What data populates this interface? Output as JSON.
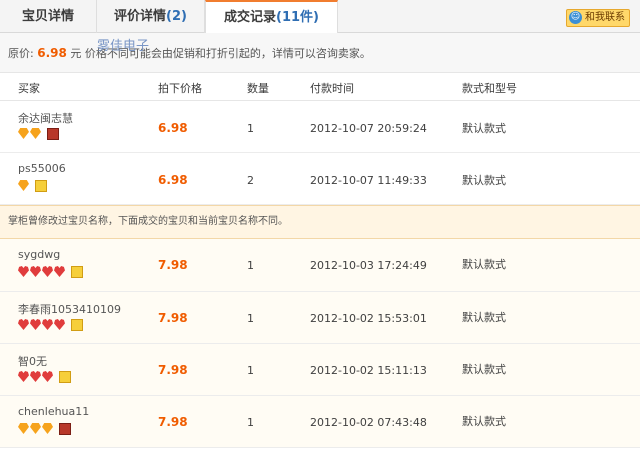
{
  "tabs": [
    {
      "label": "宝贝详情"
    },
    {
      "label": "评价详情",
      "count": "(2)"
    },
    {
      "label": "成交记录",
      "count": "(11件)"
    }
  ],
  "contact": {
    "label": "和我联系",
    "icon": "chat-icon"
  },
  "pricebar": {
    "label": "原价:",
    "price": "6.98",
    "unit": "元",
    "note": "价格不同可能会由促销和打折引起的，详情可以咨询卖家。",
    "brand": "雾佳电子"
  },
  "columns": [
    "买家",
    "拍下价格",
    "数量",
    "付款时间",
    "款式和型号"
  ],
  "rows_a": [
    {
      "buyer": "余达闽志慧",
      "price": "6.98",
      "qty": "1",
      "time": "2012-10-07 20:59:24",
      "style": "默认款式"
    },
    {
      "buyer": "ps55006",
      "price": "6.98",
      "qty": "2",
      "time": "2012-10-07 11:49:33",
      "style": "默认款式"
    }
  ],
  "notice": "掌柜曾修改过宝贝名称，下面成交的宝贝和当前宝贝名称不同。",
  "rows_b": [
    {
      "buyer": "sygdwg",
      "price": "7.98",
      "qty": "1",
      "time": "2012-10-03 17:24:49",
      "style": "默认款式"
    },
    {
      "buyer": "李春雨1053410109",
      "price": "7.98",
      "qty": "1",
      "time": "2012-10-02 15:53:01",
      "style": "默认款式"
    },
    {
      "buyer": "智0无",
      "price": "7.98",
      "qty": "1",
      "time": "2012-10-02 15:11:13",
      "style": "默认款式"
    },
    {
      "buyer": "chenlehua11",
      "price": "7.98",
      "qty": "1",
      "time": "2012-10-02 07:43:48",
      "style": "默认款式"
    }
  ],
  "colors": {
    "accent": "#f17d2f",
    "price": "#f05c00",
    "notice_bg": "#fff5e3"
  }
}
